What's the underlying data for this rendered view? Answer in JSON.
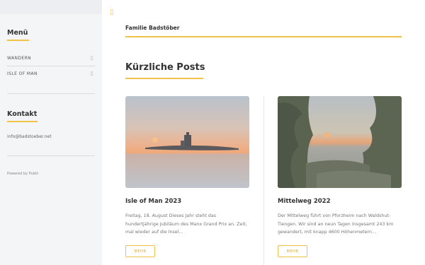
{
  "sidebar": {
    "menu_heading": "Menü",
    "items": [
      {
        "label": "WANDERN",
        "icon": "chevron-down-icon"
      },
      {
        "label": "ISLE OF MAN",
        "icon": "chevron-down-icon"
      }
    ],
    "contact_heading": "Kontakt",
    "contact_email": "info@badstoeber.net",
    "powered_by": "Powered by Publii"
  },
  "header": {
    "menu_icon": "menu-icon",
    "site_title": "Familie Badstöber"
  },
  "main": {
    "section_title": "Kürzliche Posts",
    "posts": [
      {
        "title": "Isle of Man 2023",
        "excerpt": "Freitag, 18. August Dieses Jahr steht das hundertjährige Jubiläum des Manx Grand Prix an. Zeit, mal wieder auf die Insel…",
        "more_label": "MEHR",
        "image": "sunset-sea-lighthouse-image"
      },
      {
        "title": "Mittelweg 2022",
        "excerpt": "Der Mittelweg führt von Pforzheim nach Waldshut-Tiengen. Wir sind an neun Tagen insgesamt 243 km gewandert, mit knapp 4600 Höhenmetern…",
        "more_label": "MEHR",
        "image": "sunset-forest-image"
      }
    ]
  },
  "colors": {
    "accent": "#f1c24a",
    "sidebar_bg": "#f4f5f7"
  }
}
